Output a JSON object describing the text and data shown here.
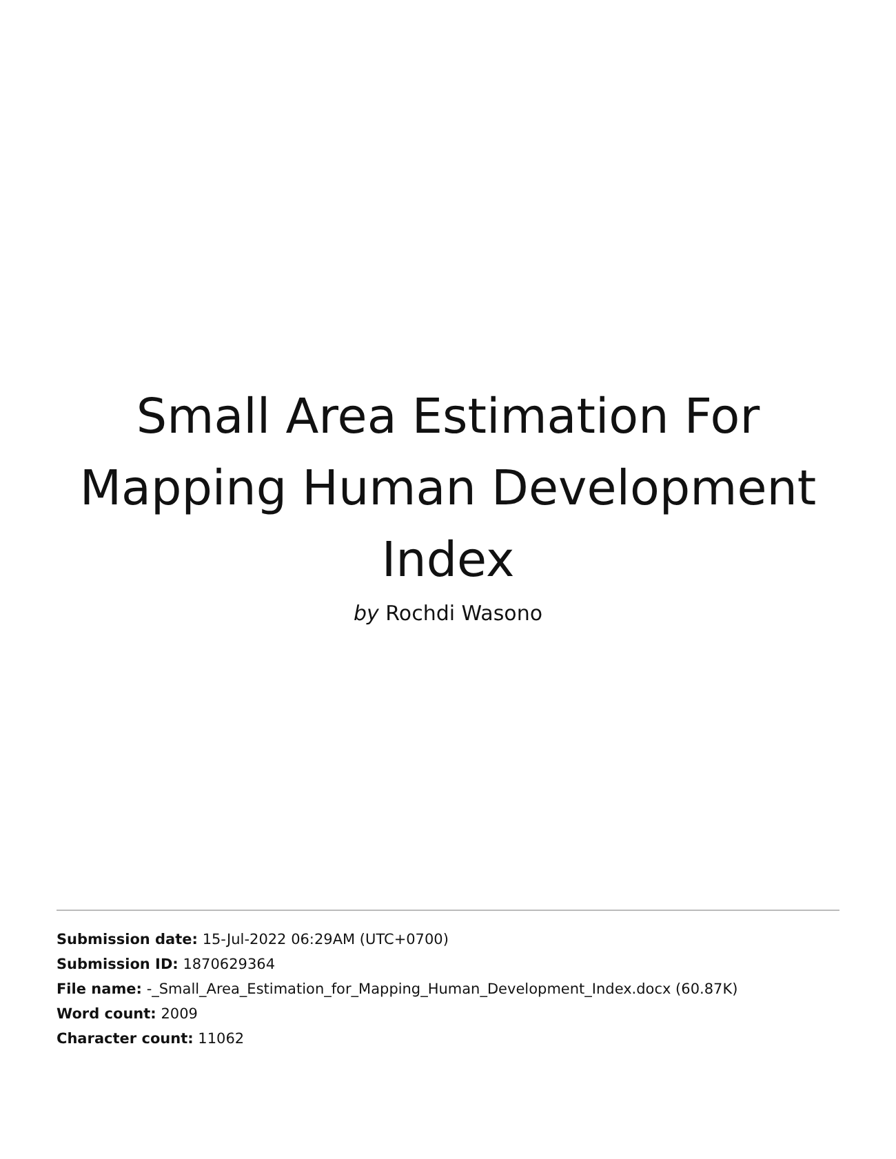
{
  "title": "Small Area Estimation For Mapping Human Development Index",
  "byline": "*by* Rochdi Wasono",
  "details": [
    "**Submission date:** 15-Jul-2022 06:29AM (UTC+0700)",
    "**Submission ID:** 1870629364",
    "**File name:** -_Small_Area_Estimation_for_Mapping_Human_Development_Index.docx (60.87K)",
    "**Word count:** 2009",
    "**Character count:** 11062"
  ]
}
